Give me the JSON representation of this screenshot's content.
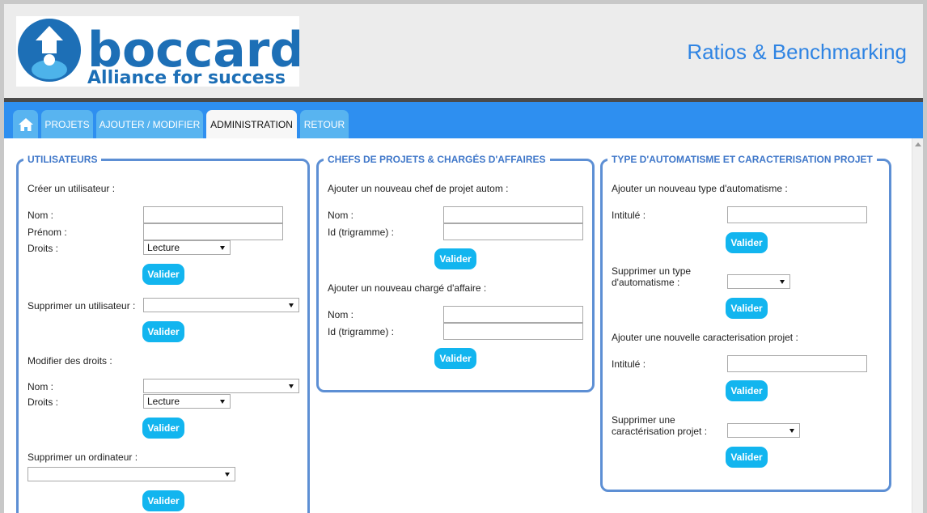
{
  "header": {
    "logo_brand": "boccard",
    "logo_tagline": "Alliance for success",
    "app_title": "Ratios & Benchmarking",
    "colors": {
      "accent": "#2f84e3",
      "nav": "#2e8ff0",
      "button": "#12b5ef",
      "panel_border": "#5d8fd4"
    }
  },
  "nav": {
    "home_icon": "home-icon",
    "tabs": [
      {
        "label": "PROJETS"
      },
      {
        "label": "AJOUTER / MODIFIER"
      },
      {
        "label": "ADMINISTRATION",
        "active": true
      },
      {
        "label": "RETOUR"
      }
    ]
  },
  "users_panel": {
    "legend": "UTILISATEURS",
    "create_title": "Créer un utilisateur :",
    "nom_label": "Nom :",
    "prenom_label": "Prénom :",
    "droits_label": "Droits :",
    "droits_value": "Lecture",
    "delete_label": "Supprimer un utilisateur :",
    "modify_title": "Modifier des droits :",
    "modify_nom_label": "Nom :",
    "modify_droits_label": "Droits :",
    "modify_droits_value": "Lecture",
    "delete_computer_label": "Supprimer un ordinateur :",
    "validate": "Valider"
  },
  "chefs_panel": {
    "legend": "CHEFS DE PROJETS & CHARGÉS D'AFFAIRES",
    "chef_title": "Ajouter un nouveau chef de projet autom :",
    "charge_title": "Ajouter un nouveau chargé d'affaire :",
    "nom_label": "Nom :",
    "id_label": "Id (trigramme) :",
    "validate": "Valider"
  },
  "types_panel": {
    "legend": "TYPE D'AUTOMATISME ET CARACTERISATION PROJET",
    "add_type_title": "Ajouter un nouveau type d'automatisme :",
    "intitule_label": "Intitulé :",
    "delete_type_label_1": "Supprimer un type",
    "delete_type_label_2": "d'automatisme :",
    "add_carac_title": "Ajouter une nouvelle caracterisation projet :",
    "intitule2_label": "Intitulé :",
    "delete_carac_label_1": "Supprimer une",
    "delete_carac_label_2": "caractérisation projet :",
    "validate": "Valider"
  }
}
